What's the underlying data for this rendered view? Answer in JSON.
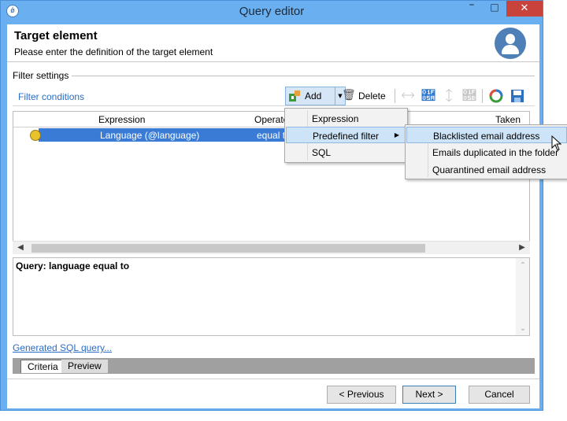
{
  "window": {
    "title": "Query editor",
    "app_icon_glyph": "ǿ"
  },
  "header": {
    "title": "Target element",
    "subtitle": "Please enter the definition of the target element"
  },
  "filter_settings_label": "Filter settings",
  "filter_conditions_label": "Filter conditions",
  "toolbar": {
    "add_label": "Add",
    "delete_label": "Delete"
  },
  "grid": {
    "columns": [
      "Expression",
      "Operato",
      "Taken in"
    ],
    "rows": [
      {
        "expression": "Language (@language)",
        "operator": "equal t"
      }
    ]
  },
  "query_text": "Query: language equal to",
  "sql_link": "Generated SQL query...",
  "tabs": [
    "Criteria",
    "Preview"
  ],
  "buttons": {
    "previous": "< Previous",
    "next": "Next >",
    "cancel": "Cancel"
  },
  "add_menu": {
    "items": [
      "Expression",
      "Predefined filter",
      "SQL"
    ]
  },
  "predefined_submenu": {
    "items": [
      "Blacklisted email address",
      "Emails duplicated in the folder",
      "Quarantined email address"
    ]
  },
  "colors": {
    "accent": "#3a7bd5",
    "titlebar": "#6ab0f0",
    "link": "#2b6cc4",
    "close": "#c7433b"
  }
}
